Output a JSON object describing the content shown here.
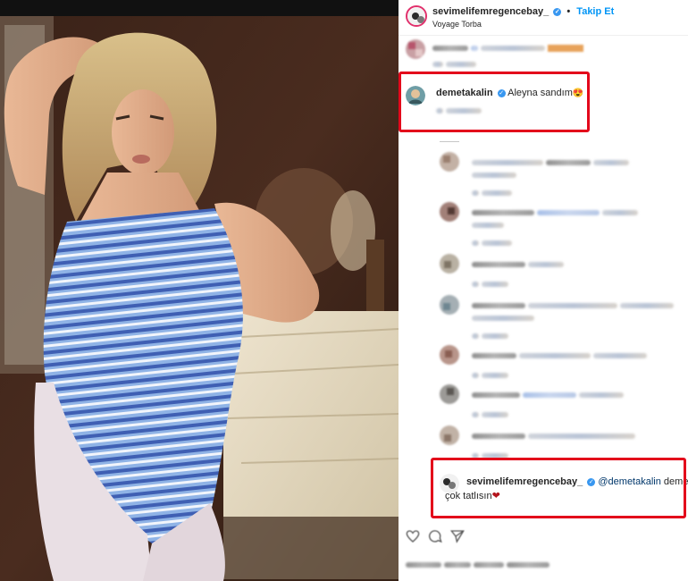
{
  "post": {
    "username": "sevimelifemregencebay_",
    "verified_mark": "✓",
    "separator": "•",
    "follow_label": "Takip Et",
    "location": "Voyage Torba"
  },
  "comments": {
    "demet": {
      "username": "demetakalin",
      "text": "Aleyna sandım",
      "emoji": "😍"
    },
    "reply": {
      "username": "sevimelifemregencebay_",
      "mention": "@demetakalin",
      "text_line1": "demetçim",
      "text_line2": "çok tatlısın",
      "emoji": "❤"
    }
  },
  "icons": {
    "like": "heart-icon",
    "comment": "comment-icon",
    "share": "share-icon"
  },
  "colors": {
    "highlight": "#e3071b",
    "verified": "#3897f0",
    "follow": "#0095f6"
  }
}
